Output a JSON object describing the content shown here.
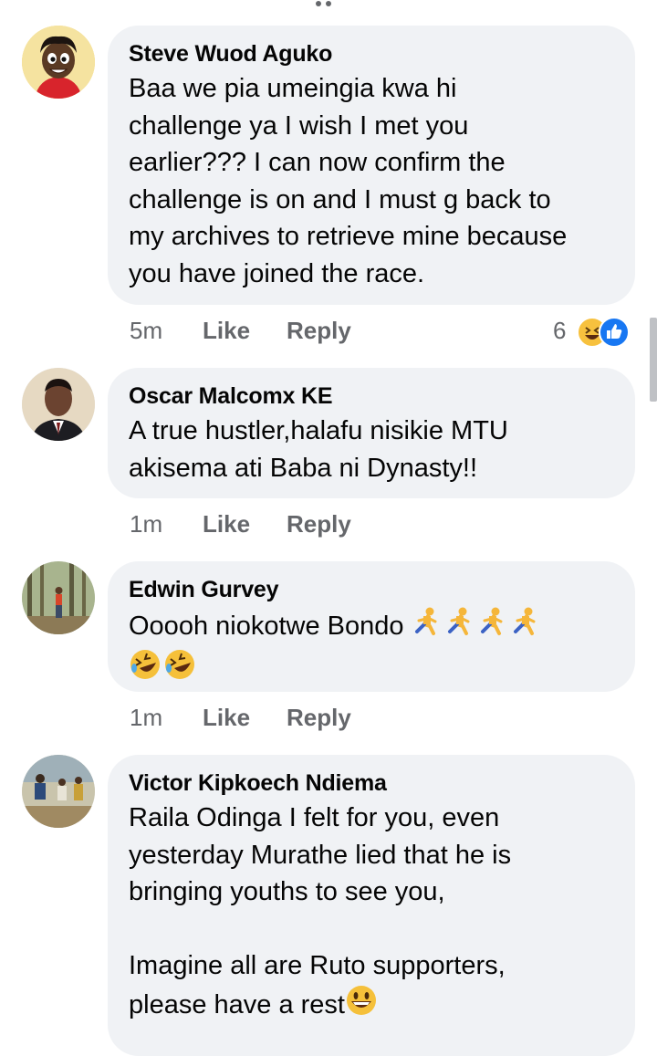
{
  "comments": [
    {
      "author": "Steve Wuod Aguko",
      "text": "Baa we pia umeingia kwa hi\nchallenge ya I wish I met you\nearlier??? I can now confirm the\nchallenge is on and I must g back to\nmy archives to retrieve mine because\nyou have joined the race.",
      "time": "5m",
      "like_label": "Like",
      "reply_label": "Reply",
      "reaction_count": "6",
      "reactions": [
        "haha-icon",
        "like-icon"
      ]
    },
    {
      "author": "Oscar Malcomx KE",
      "text": "A true hustler,halafu nisikie MTU\nakisema ati Baba ni Dynasty!!",
      "time": "1m",
      "like_label": "Like",
      "reply_label": "Reply"
    },
    {
      "author": "Edwin Gurvey",
      "text": "Ooooh niokotwe Bondo",
      "emoji_trailing": [
        "running-person-emoji",
        "running-person-emoji",
        "running-person-emoji",
        "running-person-emoji"
      ],
      "emoji_line2": [
        "rolling-laughing-emoji",
        "rolling-laughing-emoji"
      ],
      "time": "1m",
      "like_label": "Like",
      "reply_label": "Reply"
    },
    {
      "author": "Victor Kipkoech Ndiema",
      "text": "Raila Odinga I felt for you, even\nyesterday Murathe lied that he is\nbringing youths to see you,\n\nImagine all are Ruto supporters,\nplease have a rest",
      "emoji_trailing": [
        "grinning-face-emoji"
      ]
    }
  ],
  "colors": {
    "bubble": "#f0f2f5",
    "secondary_text": "#65676b",
    "like_blue": "#1877f2",
    "haha_yellow": "#f7c13e"
  }
}
